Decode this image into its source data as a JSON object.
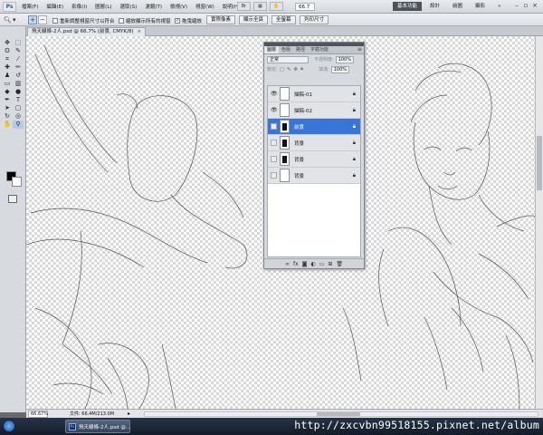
{
  "app": {
    "logo": "Ps"
  },
  "menubar": {
    "items": [
      "檔案(F)",
      "編輯(E)",
      "影像(I)",
      "圖層(L)",
      "選取(S)",
      "濾鏡(T)",
      "檢視(V)",
      "視窗(W)",
      "說明(H)"
    ],
    "zoom": "66.7",
    "workspaces": [
      "基本功能",
      "設計",
      "繪圖",
      "攝影"
    ],
    "more": "»"
  },
  "options": {
    "checkbox1_label": "重新調整視窗尺寸以符合",
    "checkbox2_label": "縮放顯示所有的視窗",
    "checkbox3_label": "拖曳縮放",
    "btn_actual": "實際像素",
    "btn_fit": "顯示全頁",
    "btn_fill": "全螢幕",
    "btn_print": "列印尺寸"
  },
  "document": {
    "tab_title": "飛天線條-2人.psd @ 66.7% (前景, CMYK/8)",
    "close": "×"
  },
  "layers_panel": {
    "tabs": [
      "圖層",
      "色版",
      "路徑",
      "字體功能"
    ],
    "blend_mode": "正常",
    "opacity_label": "不透明度:",
    "opacity": "100%",
    "lock_label": "鎖定:",
    "fill_label": "填滿:",
    "fill": "100%",
    "layers": [
      {
        "name": "描稿-01",
        "visible": true,
        "selected": false
      },
      {
        "name": "描稿-02",
        "visible": true,
        "selected": false
      },
      {
        "name": "前景",
        "visible": false,
        "selected": true
      },
      {
        "name": "背景",
        "visible": false,
        "selected": false
      },
      {
        "name": "背景",
        "visible": false,
        "selected": false
      },
      {
        "name": "背景",
        "visible": false,
        "selected": false
      }
    ]
  },
  "statusbar": {
    "zoom": "66.67%",
    "doc_info": "文件: 66.4M/213.0M"
  },
  "taskbar": {
    "item_label": "飛天線條-2人.psd @...",
    "item_icon": "Ps",
    "watermark": "http://zxcvbn99518155.pixnet.net/album"
  },
  "colors": {
    "selection": "#3875d7",
    "active_workspace": "#4d5258",
    "taskbar": "#1b2533"
  }
}
